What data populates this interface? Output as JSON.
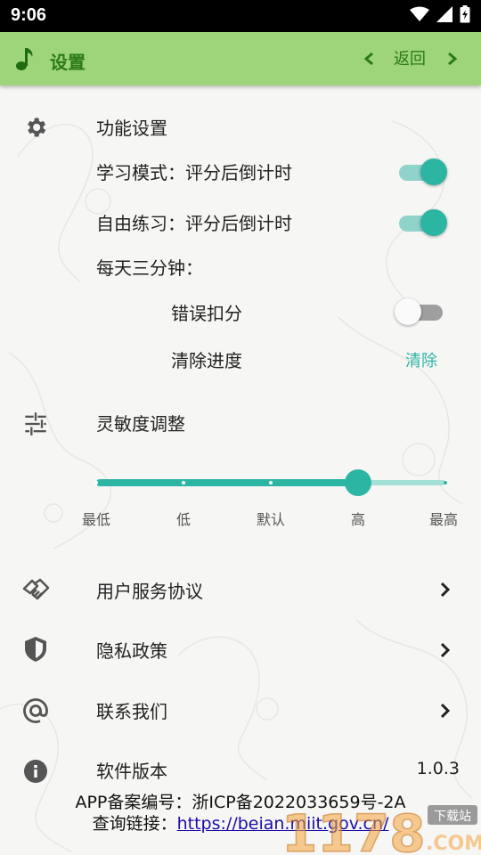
{
  "status": {
    "time": "9:06"
  },
  "header": {
    "title": "设置",
    "back_label": "返回"
  },
  "function_section": {
    "heading": "功能设置",
    "study_mode": {
      "label": "学习模式：评分后倒计时",
      "enabled": true
    },
    "free_practice": {
      "label": "自由练习：评分后倒计时",
      "enabled": true
    },
    "daily": {
      "label": "每天三分钟："
    },
    "error_deduct": {
      "label": "错误扣分",
      "enabled": false
    },
    "clear_progress": {
      "label": "清除进度",
      "action": "清除"
    }
  },
  "sensitivity": {
    "heading": "灵敏度调整",
    "levels": [
      "最低",
      "低",
      "默认",
      "高",
      "最高"
    ],
    "selected_index": 3
  },
  "links": {
    "user_agreement": "用户服务协议",
    "privacy_policy": "隐私政策",
    "contact_us": "联系我们",
    "software_version": "软件版本",
    "version_value": "1.0.3"
  },
  "footer": {
    "record_text": "APP备案编号：浙ICP备2022033659号-2A",
    "query_prefix": "查询链接：",
    "query_link": "https://beian.miit.gov.cn/"
  },
  "watermark": {
    "text": "1178",
    "suffix": ".COM",
    "badge": "下载站"
  },
  "colors": {
    "accent": "#2db5a3",
    "header_bg": "#9ed47a",
    "header_fg": "#2b7a17"
  },
  "icons": {
    "status": [
      "wifi-icon",
      "signal-icon",
      "battery-icon"
    ],
    "header": [
      "music-note-icon",
      "chevron-left-icon",
      "chevron-right-icon"
    ],
    "rows": [
      "gear-icon",
      "sliders-icon",
      "handshake-icon",
      "shield-icon",
      "at-icon",
      "info-icon"
    ]
  }
}
